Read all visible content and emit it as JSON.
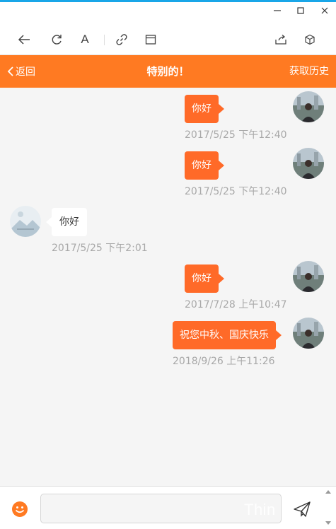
{
  "window": {
    "minimize_glyph": "—",
    "maximize_glyph": "☐",
    "close_glyph": "✕"
  },
  "toolbar": {
    "font_glyph": "A"
  },
  "header": {
    "back_label": "返回",
    "title": "特别的！",
    "history_label": "获取历史",
    "bg_color": "#ff7a22"
  },
  "messages": [
    {
      "direction": "out",
      "text": "你好",
      "time": "2017/5/25 下午12:40"
    },
    {
      "direction": "out",
      "text": "你好",
      "time": "2017/5/25 下午12:40"
    },
    {
      "direction": "in",
      "text": "你好",
      "time": "2017/5/25 下午2:01"
    },
    {
      "direction": "out",
      "text": "你好",
      "time": "2017/7/28 上午10:47"
    },
    {
      "direction": "out",
      "text": "祝您中秋、国庆快乐",
      "time": "2018/9/26 上午11:26"
    }
  ],
  "input": {
    "placeholder": "",
    "value": ""
  },
  "overlay": {
    "watermark": "Thin"
  },
  "colors": {
    "outgoing_bubble": "#ff6a28",
    "incoming_bubble": "#ffffff",
    "accent_strip": "#19a6e8"
  }
}
